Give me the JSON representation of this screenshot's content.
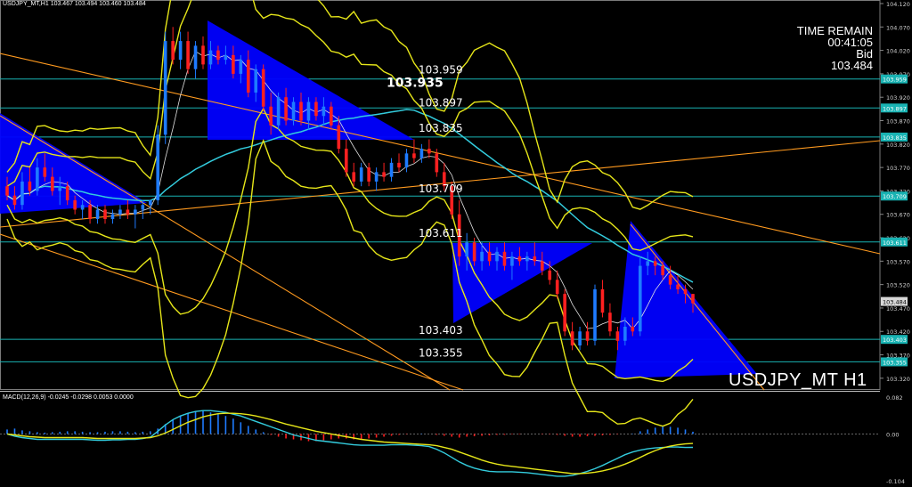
{
  "header": {
    "symbol_line": "USDJPY_MT,H1",
    "ohlc": "103.467 103.494 103.460 103.484"
  },
  "info_box": {
    "time_label": "TIME REMAIN",
    "time_value": "00:41:05",
    "bid_label": "Bid",
    "bid_value": "103.484"
  },
  "watermark": "USDJPY_MT H1",
  "macd_label": "MACD(12,26,9) -0.0245 -0.0298 0.0053 0.0000",
  "colors": {
    "bull": "#1e7bff",
    "bear": "#ff2020",
    "bollinger": "#e6e619",
    "ma_cyan": "#33ccdd",
    "trend_orange": "#ff9a1f",
    "level_line": "#19b3b3",
    "triangle": "#0000ff"
  },
  "chart_data": {
    "type": "candlestick",
    "symbol": "USDJPY_MT",
    "timeframe": "H1",
    "ylim": [
      103.295,
      104.12
    ],
    "y_ticks": [
      "104.120",
      "104.070",
      "104.020",
      "103.970",
      "103.920",
      "103.870",
      "103.820",
      "103.770",
      "103.720",
      "103.670",
      "103.620",
      "103.570",
      "103.520",
      "103.470",
      "103.420",
      "103.370",
      "103.320"
    ],
    "price_tags": [
      {
        "label": "103.959",
        "value": 103.959
      },
      {
        "label": "103.897",
        "value": 103.897
      },
      {
        "label": "103.835",
        "value": 103.835
      },
      {
        "label": "103.709",
        "value": 103.709
      },
      {
        "label": "103.611",
        "value": 103.611
      },
      {
        "label": "103.484",
        "value": 103.484,
        "current": true
      },
      {
        "label": "103.403",
        "value": 103.403
      },
      {
        "label": "103.355",
        "value": 103.355
      }
    ],
    "level_labels": [
      {
        "text": "103.959",
        "value": 103.959
      },
      {
        "text": "103.935",
        "value": 103.935,
        "emphasis": true
      },
      {
        "text": "103.897",
        "value": 103.897
      },
      {
        "text": "103.835",
        "value": 103.835
      },
      {
        "text": "103.709",
        "value": 103.709
      },
      {
        "text": "103.611",
        "value": 103.611
      },
      {
        "text": "103.403",
        "value": 103.403
      },
      {
        "text": "103.355",
        "value": 103.355
      }
    ],
    "candles": [
      [
        103.73,
        103.75,
        103.7,
        103.71
      ],
      [
        103.71,
        103.73,
        103.68,
        103.69
      ],
      [
        103.69,
        103.76,
        103.68,
        103.74
      ],
      [
        103.74,
        103.77,
        103.71,
        103.72
      ],
      [
        103.72,
        103.79,
        103.71,
        103.77
      ],
      [
        103.77,
        103.8,
        103.74,
        103.75
      ],
      [
        103.75,
        103.77,
        103.71,
        103.72
      ],
      [
        103.72,
        103.75,
        103.69,
        103.73
      ],
      [
        103.73,
        103.74,
        103.69,
        103.7
      ],
      [
        103.7,
        103.71,
        103.67,
        103.68
      ],
      [
        103.68,
        103.7,
        103.66,
        103.69
      ],
      [
        103.69,
        103.7,
        103.65,
        103.66
      ],
      [
        103.66,
        103.69,
        103.65,
        103.68
      ],
      [
        103.68,
        103.69,
        103.65,
        103.66
      ],
      [
        103.66,
        103.68,
        103.65,
        103.67
      ],
      [
        103.67,
        103.69,
        103.66,
        103.68
      ],
      [
        103.68,
        103.7,
        103.66,
        103.67
      ],
      [
        103.67,
        103.69,
        103.64,
        103.68
      ],
      [
        103.68,
        103.7,
        103.66,
        103.69
      ],
      [
        103.69,
        103.7,
        103.67,
        103.7
      ],
      [
        103.7,
        103.86,
        103.69,
        103.84
      ],
      [
        103.84,
        104.06,
        103.82,
        104.04
      ],
      [
        104.04,
        104.07,
        103.99,
        104.0
      ],
      [
        104.0,
        104.06,
        103.98,
        104.04
      ],
      [
        104.04,
        104.06,
        103.97,
        103.98
      ],
      [
        103.98,
        104.04,
        103.96,
        104.03
      ],
      [
        104.03,
        104.05,
        103.98,
        103.99
      ],
      [
        103.99,
        104.04,
        103.98,
        104.02
      ],
      [
        104.02,
        104.03,
        103.99,
        104.0
      ],
      [
        104.0,
        104.03,
        103.99,
        104.01
      ],
      [
        104.01,
        104.03,
        103.96,
        103.97
      ],
      [
        103.97,
        104.01,
        103.95,
        104.0
      ],
      [
        104.0,
        104.02,
        103.92,
        103.93
      ],
      [
        103.93,
        103.99,
        103.91,
        103.98
      ],
      [
        103.98,
        103.99,
        103.89,
        103.9
      ],
      [
        103.9,
        103.93,
        103.84,
        103.86
      ],
      [
        103.86,
        103.93,
        103.85,
        103.92
      ],
      [
        103.92,
        103.94,
        103.86,
        103.87
      ],
      [
        103.87,
        103.92,
        103.86,
        103.91
      ],
      [
        103.91,
        103.93,
        103.86,
        103.87
      ],
      [
        103.87,
        103.92,
        103.85,
        103.91
      ],
      [
        103.91,
        103.92,
        103.87,
        103.88
      ],
      [
        103.88,
        103.92,
        103.86,
        103.9
      ],
      [
        103.9,
        103.91,
        103.85,
        103.86
      ],
      [
        103.86,
        103.88,
        103.8,
        103.81
      ],
      [
        103.81,
        103.83,
        103.75,
        103.76
      ],
      [
        103.76,
        103.78,
        103.73,
        103.74
      ],
      [
        103.74,
        103.78,
        103.73,
        103.77
      ],
      [
        103.77,
        103.78,
        103.73,
        103.74
      ],
      [
        103.74,
        103.77,
        103.72,
        103.76
      ],
      [
        103.76,
        103.78,
        103.74,
        103.75
      ],
      [
        103.75,
        103.79,
        103.74,
        103.78
      ],
      [
        103.78,
        103.8,
        103.76,
        103.77
      ],
      [
        103.77,
        103.81,
        103.76,
        103.8
      ],
      [
        103.8,
        103.83,
        103.78,
        103.79
      ],
      [
        103.79,
        103.82,
        103.78,
        103.81
      ],
      [
        103.81,
        103.83,
        103.79,
        103.8
      ],
      [
        103.8,
        103.81,
        103.75,
        103.76
      ],
      [
        103.76,
        103.78,
        103.72,
        103.73
      ],
      [
        103.73,
        103.74,
        103.66,
        103.67
      ],
      [
        103.67,
        103.7,
        103.56,
        103.58
      ],
      [
        103.58,
        103.63,
        103.55,
        103.61
      ],
      [
        103.61,
        103.62,
        103.56,
        103.57
      ],
      [
        103.57,
        103.61,
        103.55,
        103.59
      ],
      [
        103.59,
        103.61,
        103.56,
        103.57
      ],
      [
        103.57,
        103.6,
        103.55,
        103.59
      ],
      [
        103.59,
        103.61,
        103.55,
        103.56
      ],
      [
        103.56,
        103.59,
        103.53,
        103.58
      ],
      [
        103.58,
        103.6,
        103.56,
        103.57
      ],
      [
        103.57,
        103.59,
        103.55,
        103.58
      ],
      [
        103.58,
        103.61,
        103.56,
        103.57
      ],
      [
        103.57,
        103.59,
        103.54,
        103.55
      ],
      [
        103.55,
        103.57,
        103.52,
        103.53
      ],
      [
        103.53,
        103.55,
        103.49,
        103.5
      ],
      [
        103.5,
        103.51,
        103.41,
        103.42
      ],
      [
        103.42,
        103.44,
        103.38,
        103.39
      ],
      [
        103.39,
        103.43,
        103.38,
        103.42
      ],
      [
        103.42,
        103.44,
        103.39,
        103.4
      ],
      [
        103.4,
        103.52,
        103.39,
        103.51
      ],
      [
        103.51,
        103.53,
        103.45,
        103.46
      ],
      [
        103.46,
        103.48,
        103.41,
        103.42
      ],
      [
        103.42,
        103.43,
        103.38,
        103.4
      ],
      [
        103.4,
        103.45,
        103.39,
        103.43
      ],
      [
        103.43,
        103.45,
        103.41,
        103.42
      ],
      [
        103.42,
        103.58,
        103.41,
        103.56
      ],
      [
        103.56,
        103.59,
        103.54,
        103.57
      ],
      [
        103.57,
        103.58,
        103.54,
        103.56
      ],
      [
        103.56,
        103.57,
        103.53,
        103.54
      ],
      [
        103.54,
        103.56,
        103.51,
        103.52
      ],
      [
        103.52,
        103.54,
        103.5,
        103.51
      ],
      [
        103.51,
        103.52,
        103.48,
        103.5
      ],
      [
        103.5,
        103.5,
        103.46,
        103.48
      ]
    ],
    "macd": {
      "ylim": [
        -0.104,
        0.082
      ],
      "y_ticks": [
        "0.082",
        "0.00",
        "-0.104"
      ],
      "histogram": [
        0.01,
        0.012,
        0.008,
        0.006,
        0.004,
        0.003,
        0.004,
        0.005,
        0.006,
        0.006,
        0.005,
        0.004,
        0.004,
        0.005,
        0.006,
        0.006,
        0.005,
        0.004,
        0.005,
        0.006,
        0.012,
        0.022,
        0.032,
        0.04,
        0.046,
        0.05,
        0.052,
        0.048,
        0.044,
        0.04,
        0.034,
        0.026,
        0.018,
        0.01,
        0.004,
        -0.002,
        -0.006,
        -0.01,
        -0.012,
        -0.014,
        -0.016,
        -0.016,
        -0.014,
        -0.012,
        -0.01,
        -0.01,
        -0.012,
        -0.012,
        -0.01,
        -0.008,
        -0.006,
        -0.004,
        -0.002,
        -0.001,
        0.0,
        0.001,
        0.0,
        -0.002,
        -0.004,
        -0.006,
        -0.008,
        -0.006,
        -0.005,
        -0.004,
        -0.003,
        -0.002,
        -0.002,
        -0.001,
        -0.001,
        0.0,
        0.0,
        -0.001,
        -0.001,
        -0.002,
        -0.004,
        -0.006,
        -0.006,
        -0.005,
        -0.004,
        -0.003,
        -0.002,
        -0.001,
        0.0,
        0.001,
        0.006,
        0.01,
        0.014,
        0.016,
        0.016,
        0.014,
        0.01,
        0.005
      ],
      "signal": [
        0.0,
        -0.002,
        -0.004,
        -0.006,
        -0.007,
        -0.008,
        -0.008,
        -0.008,
        -0.008,
        -0.008,
        -0.008,
        -0.009,
        -0.01,
        -0.01,
        -0.01,
        -0.01,
        -0.01,
        -0.01,
        -0.009,
        -0.008,
        -0.004,
        0.002,
        0.01,
        0.018,
        0.026,
        0.032,
        0.038,
        0.042,
        0.045,
        0.046,
        0.046,
        0.045,
        0.043,
        0.04,
        0.036,
        0.032,
        0.027,
        0.022,
        0.018,
        0.014,
        0.01,
        0.006,
        0.003,
        0.0,
        -0.003,
        -0.006,
        -0.009,
        -0.012,
        -0.014,
        -0.016,
        -0.018,
        -0.019,
        -0.02,
        -0.021,
        -0.022,
        -0.023,
        -0.024,
        -0.026,
        -0.03,
        -0.034,
        -0.04,
        -0.046,
        -0.052,
        -0.058,
        -0.063,
        -0.067,
        -0.07,
        -0.072,
        -0.074,
        -0.076,
        -0.078,
        -0.08,
        -0.082,
        -0.084,
        -0.086,
        -0.088,
        -0.088,
        -0.087,
        -0.085,
        -0.082,
        -0.078,
        -0.073,
        -0.067,
        -0.06,
        -0.052,
        -0.044,
        -0.037,
        -0.031,
        -0.027,
        -0.024,
        -0.022,
        -0.021
      ],
      "macd_line": [
        0.0,
        -0.005,
        -0.008,
        -0.01,
        -0.012,
        -0.012,
        -0.012,
        -0.012,
        -0.012,
        -0.012,
        -0.012,
        -0.013,
        -0.014,
        -0.014,
        -0.013,
        -0.013,
        -0.012,
        -0.012,
        -0.01,
        -0.007,
        0.006,
        0.02,
        0.032,
        0.04,
        0.046,
        0.05,
        0.052,
        0.052,
        0.05,
        0.048,
        0.044,
        0.04,
        0.034,
        0.028,
        0.022,
        0.016,
        0.01,
        0.004,
        -0.002,
        -0.006,
        -0.01,
        -0.014,
        -0.016,
        -0.018,
        -0.02,
        -0.022,
        -0.024,
        -0.025,
        -0.025,
        -0.025,
        -0.025,
        -0.024,
        -0.024,
        -0.024,
        -0.025,
        -0.026,
        -0.028,
        -0.034,
        -0.042,
        -0.052,
        -0.062,
        -0.07,
        -0.076,
        -0.08,
        -0.083,
        -0.084,
        -0.084,
        -0.084,
        -0.085,
        -0.086,
        -0.088,
        -0.09,
        -0.092,
        -0.094,
        -0.094,
        -0.092,
        -0.088,
        -0.083,
        -0.077,
        -0.07,
        -0.062,
        -0.054,
        -0.046,
        -0.04,
        -0.036,
        -0.033,
        -0.031,
        -0.03,
        -0.029,
        -0.029,
        -0.03,
        -0.0298
      ]
    }
  }
}
